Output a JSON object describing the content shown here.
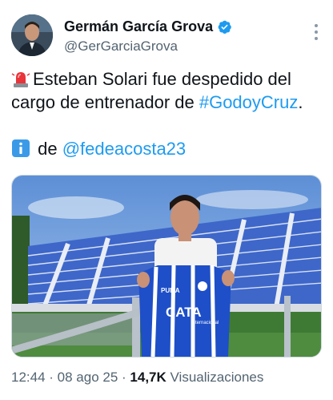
{
  "author": {
    "name": "Germán García Grova",
    "handle": "@GerGarciaGrova",
    "verified": true,
    "avatar_icon": "avatar-photo",
    "verified_icon": "verified-badge-icon",
    "more_icon": "more-vertical-icon"
  },
  "tweet": {
    "line1_emoji": "rotating-light-emoji",
    "line1_text": "Esteban Solari fue despedido del",
    "line2_text": "cargo de entrenador de ",
    "hashtag": "#GodoyCruz",
    "line2_end": ".",
    "line3_emoji": "info-emoji",
    "line3_text": " de ",
    "mention": "@fedeacosta23"
  },
  "media": {
    "description_icon": "photo-coach-stadium",
    "jersey_text": "CATA",
    "jersey_sub": "Internacional",
    "jersey_brand": "PUMA"
  },
  "meta": {
    "time": "12:44",
    "sep1": " · ",
    "date": "08 ago 25",
    "sep2": " · ",
    "views_count": "14,7K",
    "views_label": " Visualizaciones"
  },
  "colors": {
    "link": "#1d9bf0",
    "secondary": "#536471",
    "verified": "#1d9bf0",
    "jersey_blue": "#1e4fc8",
    "stands_blue": "#3e67c9"
  }
}
